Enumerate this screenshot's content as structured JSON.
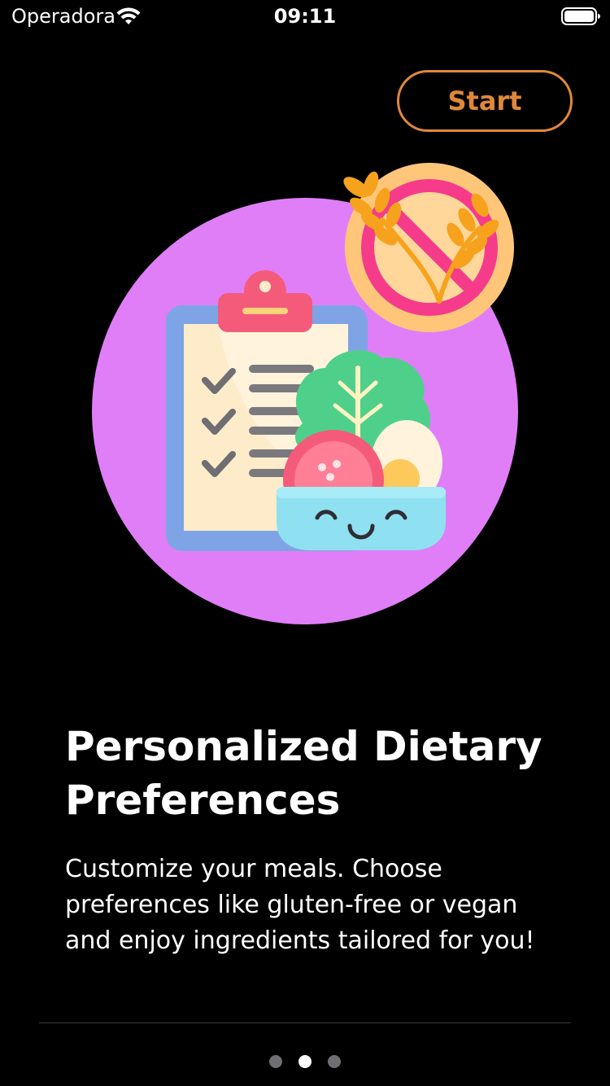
{
  "status_bar": {
    "carrier": "Operadora",
    "time": "09:11"
  },
  "header": {
    "start_label": "Start"
  },
  "onboarding": {
    "title": "Personalized Dietary Preferences",
    "description": "Customize your meals. Choose preferences like gluten-free or vegan and enjoy ingredients tailored for you!"
  },
  "pagination": {
    "total_pages": 3,
    "current_page": 2
  },
  "colors": {
    "background": "#000000",
    "accent": "#E0883A",
    "circle": "#E07EF8",
    "dot_inactive": "#6E6E73",
    "dot_active": "#FFFFFF"
  },
  "icons": [
    "wifi-icon",
    "battery-icon",
    "diet-illustration",
    "no-gluten-icon",
    "clipboard-icon",
    "salad-bowl-icon"
  ]
}
